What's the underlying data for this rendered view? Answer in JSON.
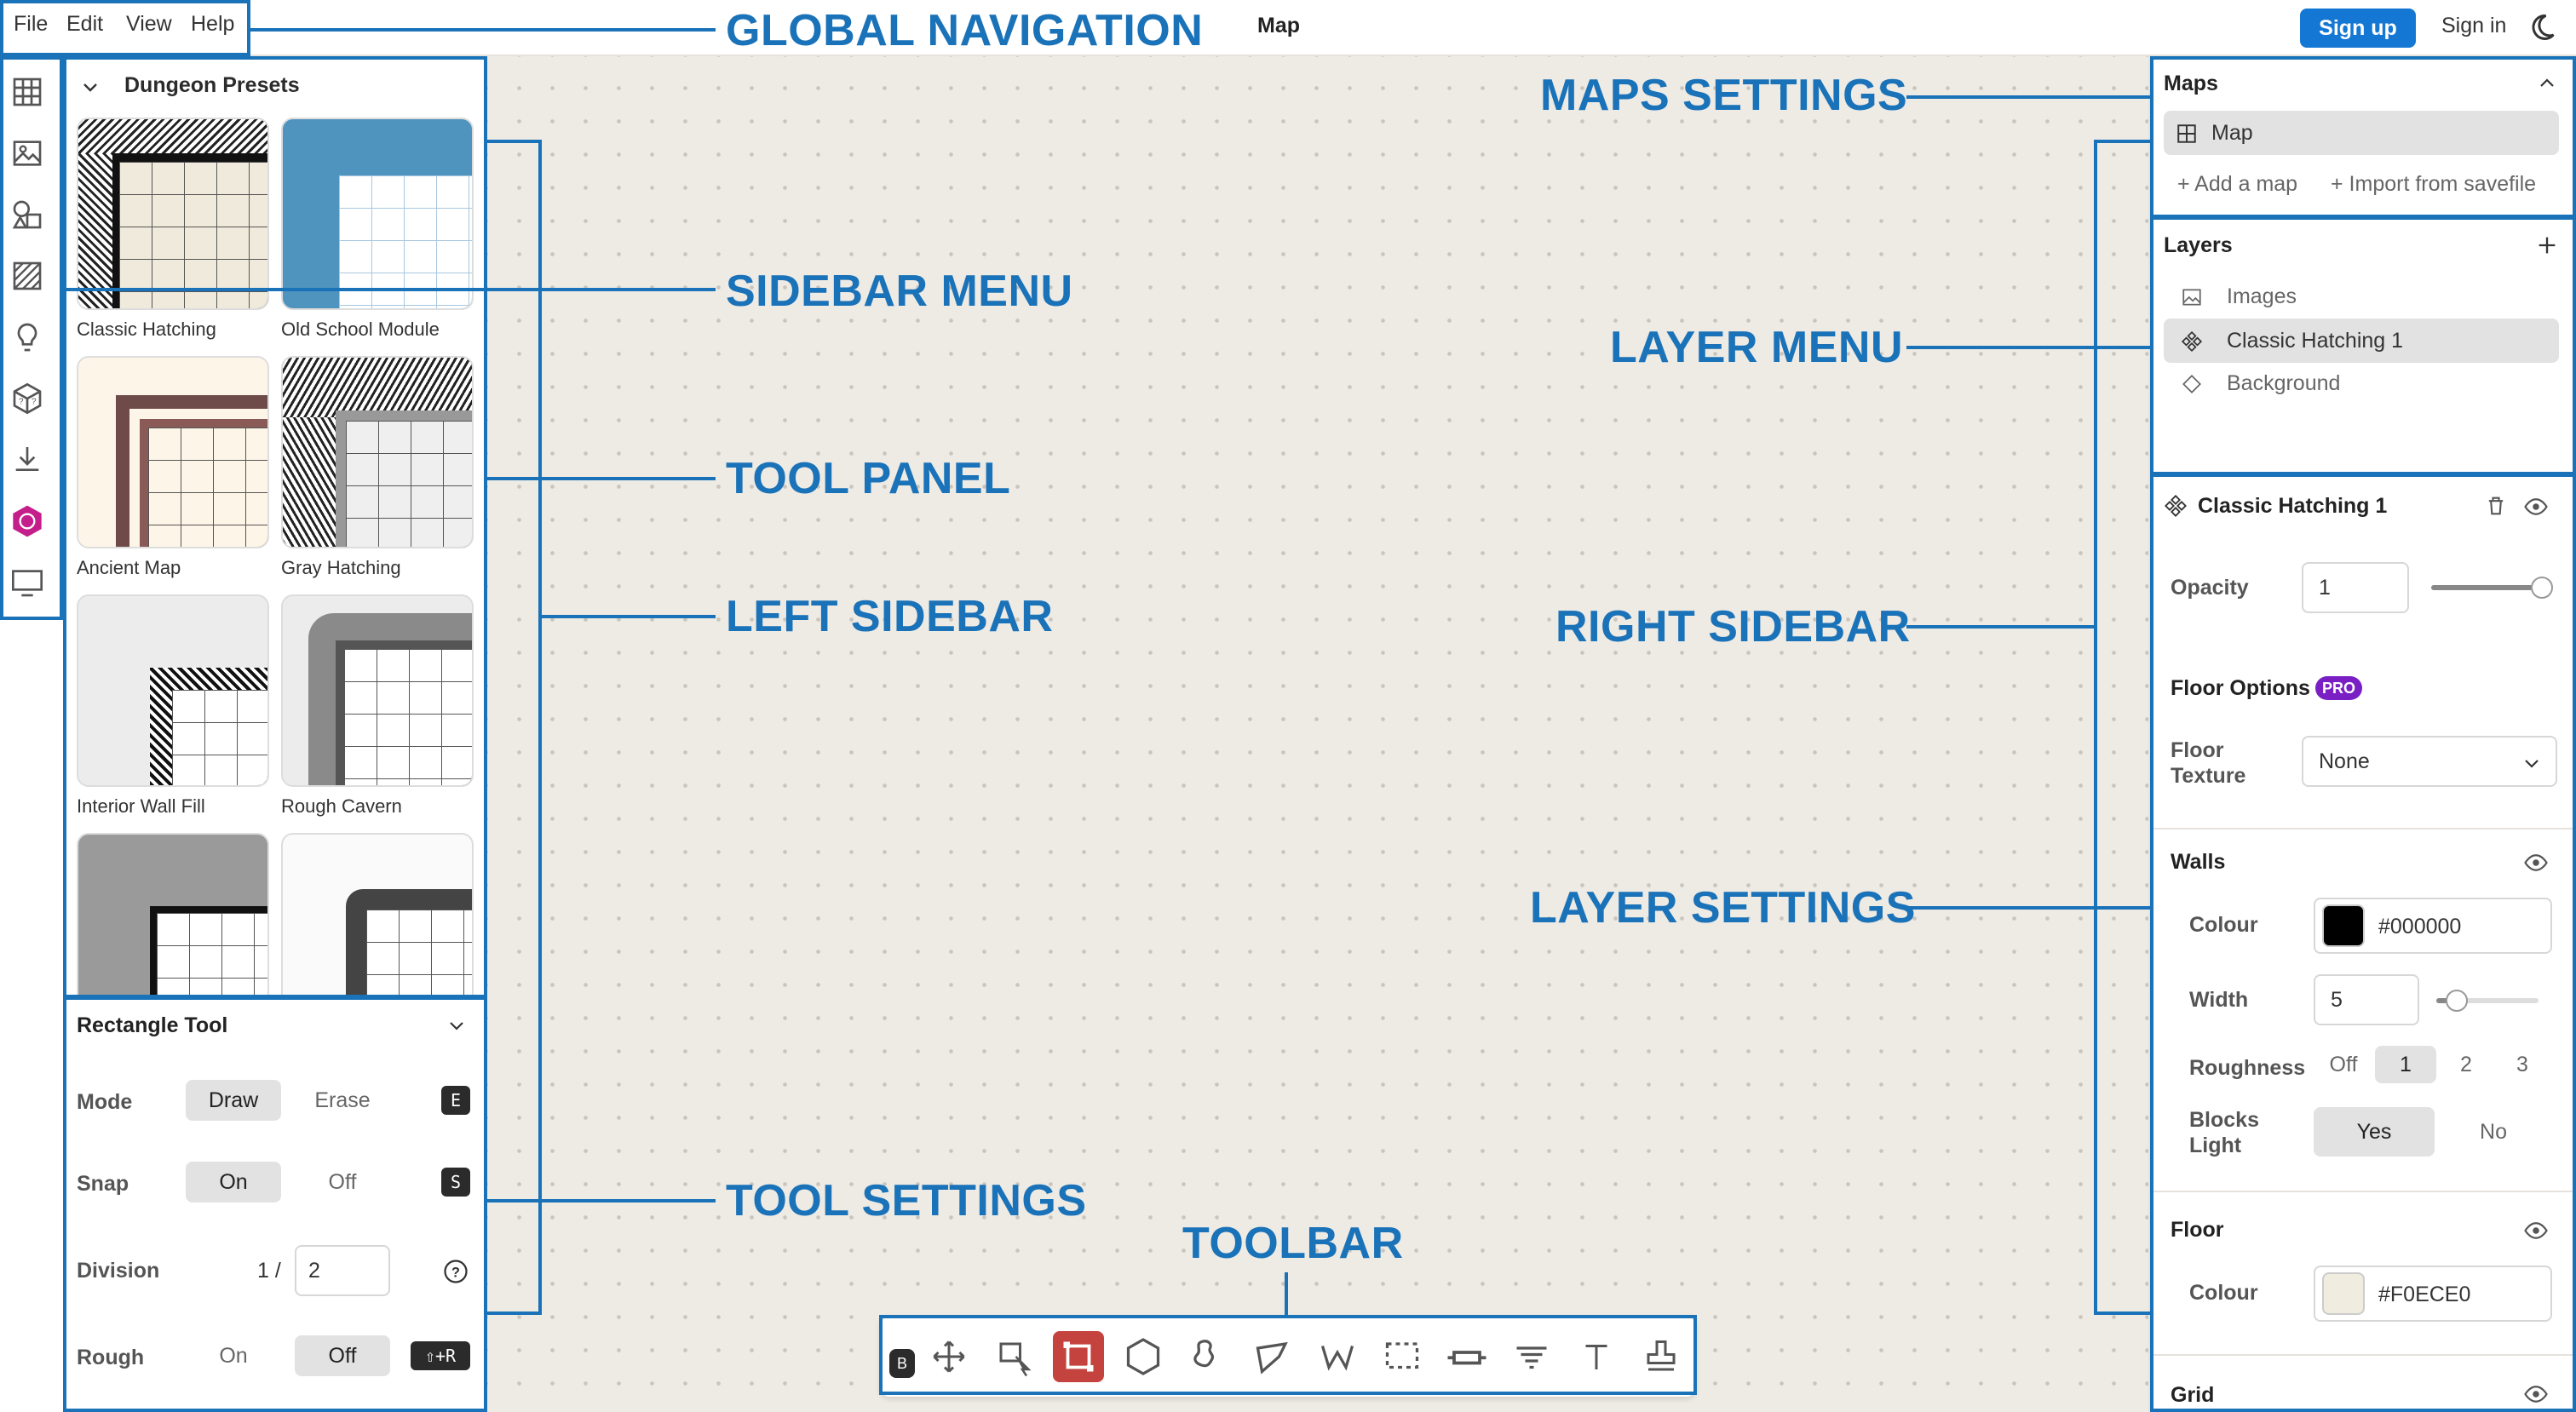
{
  "menu": {
    "items": [
      "File",
      "Edit",
      "View",
      "Help"
    ]
  },
  "header": {
    "map_title": "Map",
    "signup_label": "Sign up",
    "signin_label": "Sign in"
  },
  "presets": {
    "section_title": "Dungeon Presets",
    "items": [
      {
        "label": "Classic Hatching"
      },
      {
        "label": "Old School Module"
      },
      {
        "label": "Ancient Map"
      },
      {
        "label": "Gray Hatching"
      },
      {
        "label": "Interior Wall Fill"
      },
      {
        "label": "Rough Cavern"
      }
    ]
  },
  "tool_settings": {
    "title": "Rectangle Tool",
    "mode": {
      "label": "Mode",
      "options": [
        "Draw",
        "Erase"
      ],
      "shortcut": "E"
    },
    "snap": {
      "label": "Snap",
      "options": [
        "On",
        "Off"
      ],
      "shortcut": "S"
    },
    "division": {
      "label": "Division",
      "prefix": "1 /",
      "value": "2"
    },
    "rough": {
      "label": "Rough",
      "options": [
        "On",
        "Off"
      ],
      "shortcut": "⇧+R"
    }
  },
  "maps": {
    "title": "Maps",
    "items": [
      "Map"
    ],
    "add_label": "+ Add a map",
    "import_label": "+ Import from savefile"
  },
  "layers": {
    "title": "Layers",
    "items": [
      "Images",
      "Classic Hatching 1",
      "Background"
    ]
  },
  "layer_settings": {
    "title": "Classic Hatching 1",
    "opacity": {
      "label": "Opacity",
      "value": "1",
      "level": 1.0
    },
    "floor_options": {
      "label": "Floor Options",
      "badge": "PRO"
    },
    "floor_texture": {
      "label": "Floor Texture",
      "value": "None"
    },
    "walls": {
      "title": "Walls",
      "colour_label": "Colour",
      "colour": "#000000",
      "width_label": "Width",
      "width": "5",
      "width_level": 0.2,
      "roughness_label": "Roughness",
      "roughness_options": [
        "Off",
        "1",
        "2",
        "3"
      ],
      "blocks_light_label": "Blocks Light",
      "blocks_light_options": [
        "Yes",
        "No"
      ]
    },
    "floor": {
      "title": "Floor",
      "colour_label": "Colour",
      "colour": "#F0ECE0"
    },
    "grid": {
      "title": "Grid"
    }
  },
  "annotations": {
    "global_navigation": "GLOBAL NAVIGATION",
    "sidebar_menu": "SIDEBAR MENU",
    "tool_panel": "TOOL PANEL",
    "left_sidebar": "LEFT SIDEBAR",
    "tool_settings": "TOOL SETTINGS",
    "toolbar": "TOOLBAR",
    "maps_settings": "MAPS SETTINGS",
    "layer_menu": "LAYER MENU",
    "right_sidebar": "RIGHT SIDEBAR",
    "layer_settings": "LAYER SETTINGS"
  },
  "colors": {
    "accent": "#1477d4",
    "annotation": "#1a72b8",
    "active_tool": "#c5433f",
    "canvas": "#eeeae4",
    "pro_badge": "#7a1fc4"
  }
}
